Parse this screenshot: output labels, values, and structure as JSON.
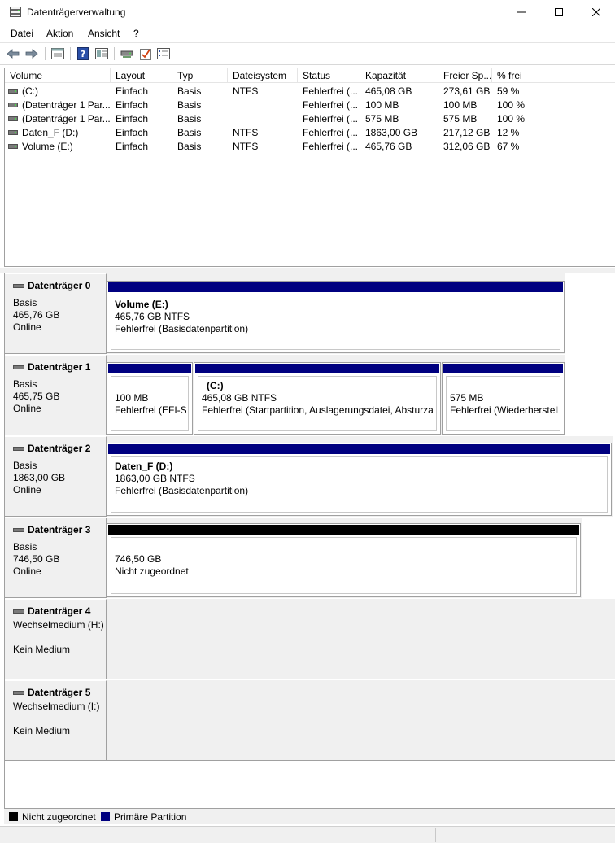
{
  "window": {
    "title": "Datenträgerverwaltung"
  },
  "menu": [
    "Datei",
    "Aktion",
    "Ansicht",
    "?"
  ],
  "toolbar": {
    "buttons": [
      "back-arrow-icon",
      "forward-arrow-icon",
      "properties-icon",
      "help-icon",
      "view-icon",
      "connect-icon",
      "check-icon",
      "list-icon"
    ]
  },
  "volume_list": {
    "columns": [
      "Volume",
      "Layout",
      "Typ",
      "Dateisystem",
      "Status",
      "Kapazität",
      "Freier Sp...",
      "% frei"
    ],
    "rows": [
      [
        "(C:)",
        "Einfach",
        "Basis",
        "NTFS",
        "Fehlerfrei (...",
        "465,08 GB",
        "273,61 GB",
        "59 %"
      ],
      [
        "(Datenträger 1 Par...",
        "Einfach",
        "Basis",
        "",
        "Fehlerfrei (...",
        "100 MB",
        "100 MB",
        "100 %"
      ],
      [
        "(Datenträger 1 Par...",
        "Einfach",
        "Basis",
        "",
        "Fehlerfrei (...",
        "575 MB",
        "575 MB",
        "100 %"
      ],
      [
        "Daten_F (D:)",
        "Einfach",
        "Basis",
        "NTFS",
        "Fehlerfrei (...",
        "1863,00 GB",
        "217,12 GB",
        "12 %"
      ],
      [
        "Volume (E:)",
        "Einfach",
        "Basis",
        "NTFS",
        "Fehlerfrei (...",
        "465,76 GB",
        "312,06 GB",
        "67 %"
      ]
    ]
  },
  "disks": [
    {
      "name": "Datenträger 0",
      "lines": [
        "Basis",
        "465,76 GB",
        "Online"
      ],
      "partitions": [
        {
          "title": "Volume  (E:)",
          "lines": [
            "465,76 GB NTFS",
            "Fehlerfrei (Basisdatenpartition)"
          ],
          "kind": "primary"
        }
      ]
    },
    {
      "name": "Datenträger 1",
      "lines": [
        "Basis",
        "465,75 GB",
        "Online"
      ],
      "partitions": [
        {
          "title": "",
          "lines": [
            "100 MB",
            "Fehlerfrei (EFI-Systempartition)"
          ],
          "kind": "primary"
        },
        {
          "title": "(C:)",
          "lines": [
            "465,08 GB NTFS",
            "Fehlerfrei (Startpartition, Auslagerungsdatei, Absturzabbild, Primäre Partition)"
          ],
          "kind": "primary"
        },
        {
          "title": "",
          "lines": [
            "575 MB",
            "Fehlerfrei (Wiederherstellungspartition)"
          ],
          "kind": "primary"
        }
      ]
    },
    {
      "name": "Datenträger 2",
      "lines": [
        "Basis",
        "1863,00 GB",
        "Online"
      ],
      "partitions": [
        {
          "title": "Daten_F  (D:)",
          "lines": [
            "1863,00 GB NTFS",
            "Fehlerfrei (Basisdatenpartition)"
          ],
          "kind": "primary"
        }
      ]
    },
    {
      "name": "Datenträger 3",
      "lines": [
        "Basis",
        "746,50 GB",
        "Online"
      ],
      "partitions": [
        {
          "title": "",
          "lines": [
            "746,50 GB",
            "Nicht zugeordnet"
          ],
          "kind": "unallocated"
        }
      ]
    },
    {
      "name": "Datenträger 4",
      "lines": [
        "Wechselmedium (H:)",
        "",
        "Kein Medium"
      ],
      "partitions": []
    },
    {
      "name": "Datenträger 5",
      "lines": [
        "Wechselmedium (I:)",
        "",
        "Kein Medium"
      ],
      "partitions": []
    }
  ],
  "legend": [
    {
      "label": "Nicht zugeordnet",
      "color": "#000000"
    },
    {
      "label": "Primäre Partition",
      "color": "#000080"
    }
  ],
  "colors": {
    "primary": "#000080",
    "unallocated": "#000000",
    "panel": "#f0f0f0"
  }
}
